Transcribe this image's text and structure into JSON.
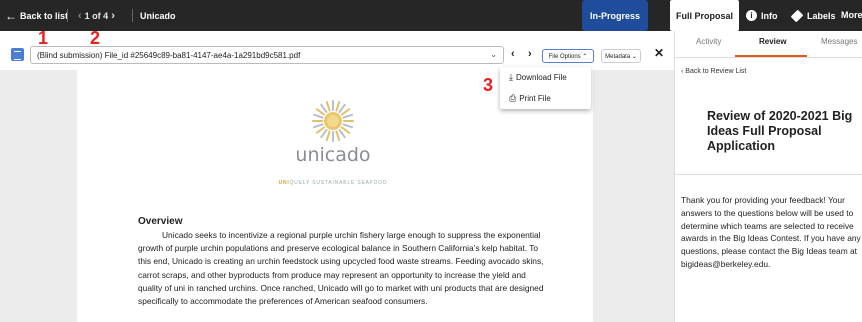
{
  "topbar": {
    "back_label": "Back to list",
    "back_arrow": "🡐",
    "pager_text": "1 of 4",
    "pager_prev": "‹",
    "pager_next": "›",
    "title": "Unicado",
    "status": "In-Progress",
    "status_color": "#1f4d9b",
    "tab_full_proposal": "Full Proposal",
    "info_label": "Info",
    "labels_label": "Labels",
    "more_label": "More ⌄"
  },
  "viewer": {
    "file_name": "(Blind submission) File_id #25649c89-ba81-4147-ae4a-1a291bd9c581.pdf",
    "select_caret": "⌄",
    "prev": "‹",
    "next": "›",
    "file_options": "File Options ⌃",
    "metadata": "Metadata ⌄",
    "close": "✕",
    "dropdown": {
      "download": "Download File",
      "print": "Print File",
      "download_icon": "download-icon",
      "print_icon": "print-icon"
    }
  },
  "document": {
    "logo_text": "unicado",
    "tagline_uni": "UNI",
    "tagline_rest": "QUELY SUSTAINABLE SEAFOOD",
    "heading": "Overview",
    "paragraph": "Unicado seeks to incentivize a regional purple urchin fishery large enough to suppress the exponential growth of purple urchin populations and preserve ecological balance in Southern California’s kelp habitat. To this end, Unicado is creating an urchin feedstock using upcycled food waste streams. Feeding avocado skins, carrot scraps, and other byproducts from produce may represent an opportunity to increase the yield and quality of uni in ranched urchins. Once ranched, Unicado will go to market with uni products that are designed specifically to accommodate the preferences of American seafood consumers."
  },
  "annotations": {
    "one": "1",
    "two": "2",
    "three": "3",
    "color": "#e82020"
  },
  "panel": {
    "tabs": [
      "Activity",
      "Review",
      "Messages"
    ],
    "active_tab_color": "#e05a1e",
    "back_label": "‹ Back to Review List",
    "review_title": "Review of 2020-2021 Big Ideas Full Proposal Application",
    "thanks": "Thank you for providing your feedback! Your answers to the questions below will be used to determine which teams are selected to receive awards in the Big Ideas Contest. If you have any questions, please contact the Big Ideas team at bigideas@berkeley.edu."
  }
}
